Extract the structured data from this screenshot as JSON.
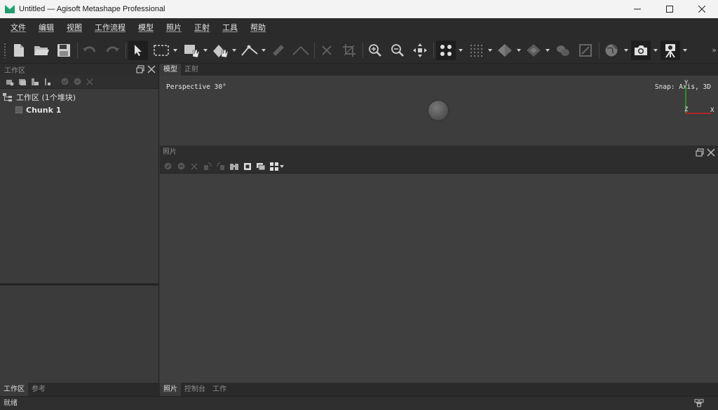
{
  "window": {
    "title": "Untitled — Agisoft Metashape Professional"
  },
  "menu": {
    "items": [
      "文件",
      "编辑",
      "视图",
      "工作流程",
      "模型",
      "照片",
      "正射",
      "工具",
      "帮助"
    ]
  },
  "toolbar": {
    "more_label": "»"
  },
  "workspace": {
    "panel_title": "工作区",
    "root_label": "工作区 (1个堆块)",
    "chunk_label": "Chunk 1"
  },
  "model_view": {
    "tabs": [
      "模型",
      "正射"
    ],
    "perspective_label": "Perspective 30°",
    "snap_label": "Snap: Axis, 3D",
    "axis_y": "Y",
    "axis_z": "Z",
    "axis_x": "X"
  },
  "photos": {
    "panel_title": "照片"
  },
  "bottom_tabs": {
    "left": [
      "工作区",
      "参考"
    ],
    "right": [
      "照片",
      "控制台",
      "工作"
    ]
  },
  "status": {
    "text": "就绪"
  },
  "colors": {
    "accent": "#1e9e6e",
    "axis_x": "#d22020",
    "axis_y": "#20b020"
  }
}
